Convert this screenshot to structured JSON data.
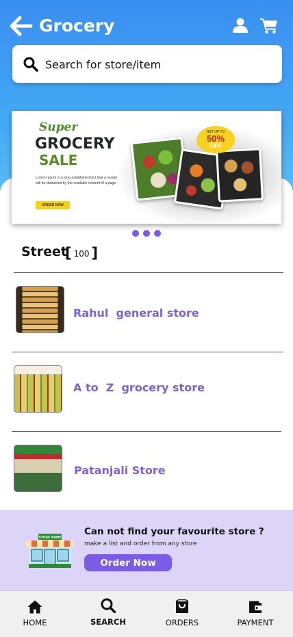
{
  "header": {
    "title": "Grocery",
    "back_icon": "arrow-left-icon",
    "user_icon": "user-icon",
    "cart_icon": "cart-icon"
  },
  "search": {
    "placeholder": "Search for store/item",
    "icon": "search-icon"
  },
  "banner": {
    "super": "Super",
    "grocery": "GROCERY",
    "sale": "SALE",
    "body": "Lorem Ipsum is a long established fact that a reader will be distracted by the readable content of a page.",
    "cta": "ORDER NOW",
    "badge_top": "GET UP TO",
    "badge_percent": "50%",
    "badge_off": "OFF",
    "carousel_dots": 3
  },
  "street": {
    "label": "Street",
    "count": "100"
  },
  "stores": [
    {
      "name": "Rahul  general store"
    },
    {
      "name": "A to  Z  grocery store"
    },
    {
      "name": "Patanjali Store"
    }
  ],
  "promo": {
    "title": "Can not find your favourite store ?",
    "subtitle": "make a list and order from any store",
    "button": "Order Now",
    "illustration": "store-front-icon",
    "sign": "STORE NAME"
  },
  "bottom_nav": [
    {
      "label": "HOME",
      "icon": "home-icon",
      "active": false
    },
    {
      "label": "SEARCH",
      "icon": "search-icon",
      "active": true
    },
    {
      "label": "ORDERS",
      "icon": "shopping-bag-icon",
      "active": false
    },
    {
      "label": "PAYMENT",
      "icon": "wallet-icon",
      "active": false
    }
  ],
  "colors": {
    "header_gradient_top": "#3a8ef0",
    "accent_purple": "#7b5ce6",
    "store_name": "#7c63d8",
    "promo_bg": "#ddd5f7"
  }
}
